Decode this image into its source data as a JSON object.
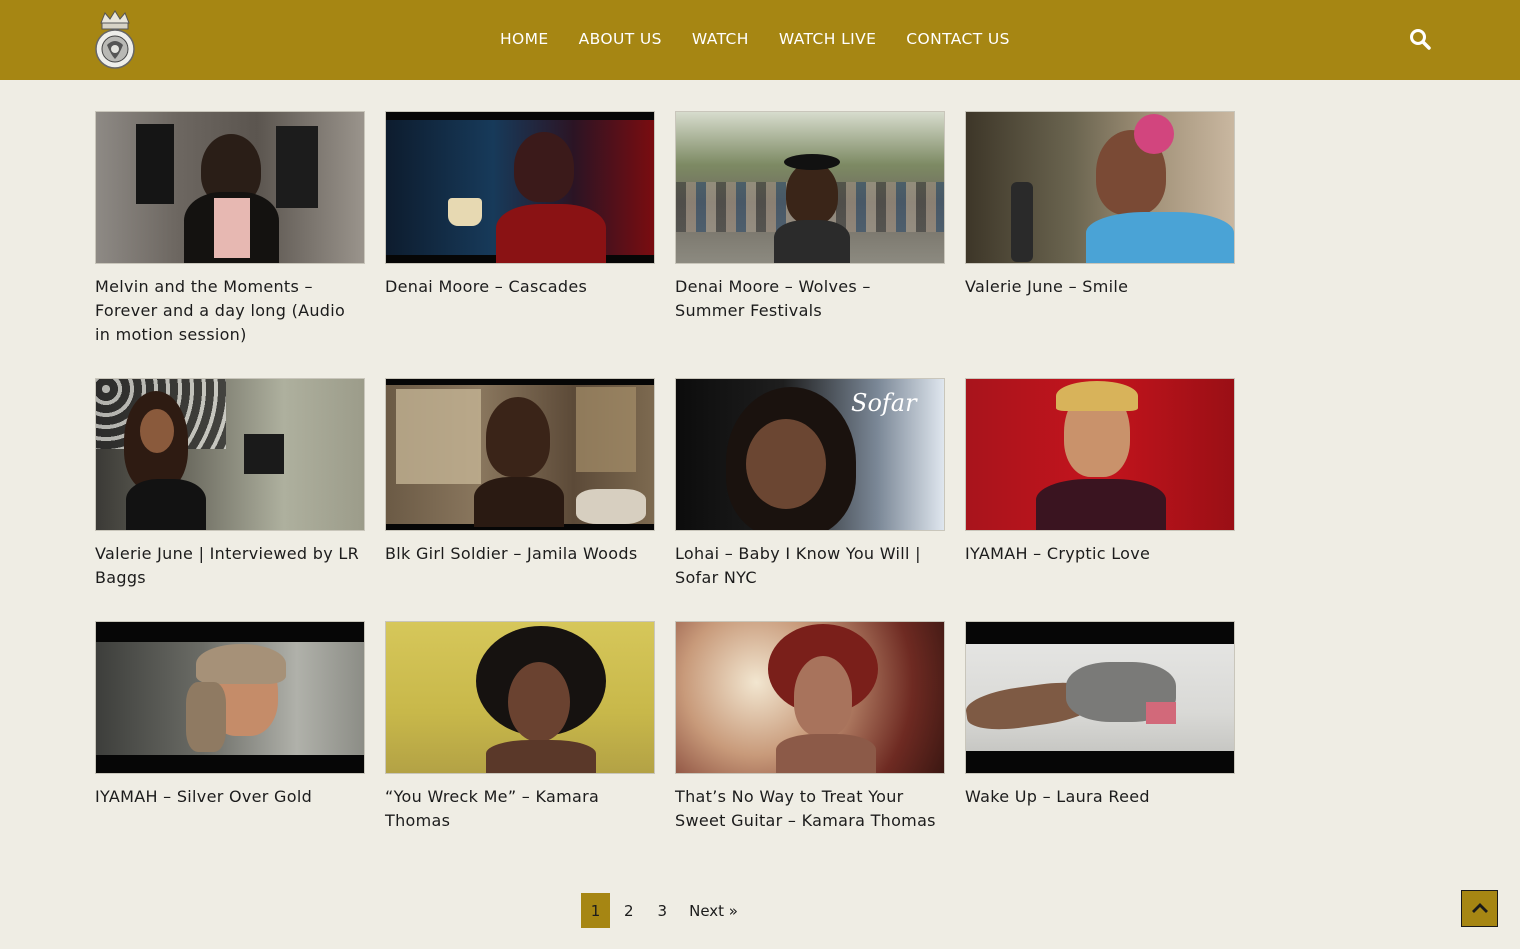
{
  "nav": {
    "items": [
      {
        "label": "HOME"
      },
      {
        "label": "ABOUT US"
      },
      {
        "label": "WATCH"
      },
      {
        "label": "WATCH LIVE"
      },
      {
        "label": "CONTACT US"
      }
    ]
  },
  "videos": [
    {
      "title": "Melvin and the Moments – Forever and a day long (Audio in motion session)"
    },
    {
      "title": "Denai Moore – Cascades"
    },
    {
      "title": "Denai Moore – Wolves – Summer Festivals"
    },
    {
      "title": "Valerie June – Smile"
    },
    {
      "title": "Valerie June | Interviewed by LR Baggs"
    },
    {
      "title": "Blk Girl Soldier – Jamila Woods"
    },
    {
      "title": "Lohai – Baby I Know You Will | Sofar NYC"
    },
    {
      "title": "IYAMAH – Cryptic Love"
    },
    {
      "title": "IYAMAH – Silver Over Gold"
    },
    {
      "title": "“You Wreck Me” – Kamara Thomas"
    },
    {
      "title": "That’s No Way to Treat Your Sweet Guitar – Kamara Thomas"
    },
    {
      "title": "Wake Up – Laura Reed"
    }
  ],
  "pagination": {
    "current": "1",
    "page2": "2",
    "page3": "3",
    "next": "Next »"
  },
  "colors": {
    "header": "#a68613",
    "background": "#efede4"
  }
}
